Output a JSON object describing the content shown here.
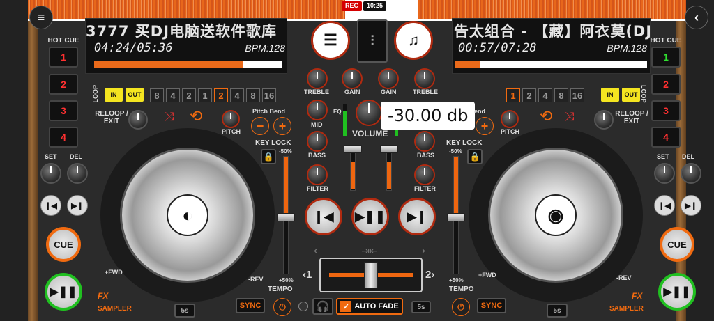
{
  "status": {
    "rec_label": "REC",
    "clock": "10:25"
  },
  "deck_a": {
    "title": "3777 买DJ电脑送软件歌库",
    "time": "04:24/05:36",
    "bpm": "BPM:128",
    "progress": 0.79,
    "hot_cue_label": "HOT CUE",
    "hot_cues": [
      "1",
      "2",
      "3",
      "4"
    ],
    "loop_label": "LOOP",
    "in_label": "IN",
    "out_label": "OUT",
    "loop_sizes": [
      "8",
      "4",
      "2",
      "1",
      "2",
      "4",
      "8",
      "16"
    ],
    "loop_selected_index": 4,
    "reloop_label": "RELOOP / EXIT",
    "pitch_label": "PITCH",
    "pitch_bend_label": "Pitch Bend",
    "set_label": "SET",
    "del_label": "DEL",
    "cue_label": "CUE",
    "play_label": "▶❚❚",
    "fx_label": "FX",
    "fwd_label": "+FWD",
    "rev_label": "-REV",
    "sampler_label": "SAMPLER",
    "loop_len": "5s",
    "key_lock_label": "KEY LOCK",
    "tempo_label": "TEMPO",
    "pitch_min": "-50%",
    "pitch_max": "+50%",
    "sync_label": "SYNC"
  },
  "deck_b": {
    "title": "告太组合 - 【藏】阿衣莫(DJ",
    "time": "00:57/07:28",
    "bpm": "BPM:128",
    "progress": 0.13,
    "hot_cue_label": "HOT CUE",
    "hot_cues": [
      "1",
      "2",
      "3",
      "4"
    ],
    "loop_label": "LOOP",
    "in_label": "IN",
    "out_label": "OUT",
    "loop_sizes": [
      "1",
      "2",
      "4",
      "8",
      "16"
    ],
    "loop_selected_index": 0,
    "reloop_label": "RELOOP / EXIT",
    "pitch_label": "PITCH",
    "pitch_bend_label": "end",
    "set_label": "SET",
    "del_label": "DEL",
    "cue_label": "CUE",
    "play_label": "▶❚❚",
    "fx_label": "FX",
    "fwd_label": "+FWD",
    "rev_label": "-REV",
    "sampler_label": "SAMPLER",
    "loop_len": "5s",
    "key_lock_label": "KEY LOCK",
    "tempo_label": "TEMPO",
    "pitch_min": "-50%",
    "pitch_max": "+50%",
    "sync_label": "SYNC"
  },
  "mixer": {
    "treble": "TREBLE",
    "gain": "GAIN",
    "mid": "MID",
    "bass": "BASS",
    "filter": "FILTER",
    "eq": "EQ",
    "volume": "VOLUME",
    "tooltip": "-30.00 db",
    "auto_fade": "AUTO FADE",
    "fade_len": "5s",
    "deck_1": "‹1",
    "deck_2": "2›"
  },
  "icons": {
    "menu": "menu-icon",
    "back": "back-icon",
    "playlist": "list-icon",
    "music": "music-note-icon",
    "mixer": "mixer-sliders-icon"
  },
  "colors": {
    "accent": "#f06a10",
    "green": "#20c020",
    "yellow": "#f4e520",
    "red": "#d50000"
  }
}
